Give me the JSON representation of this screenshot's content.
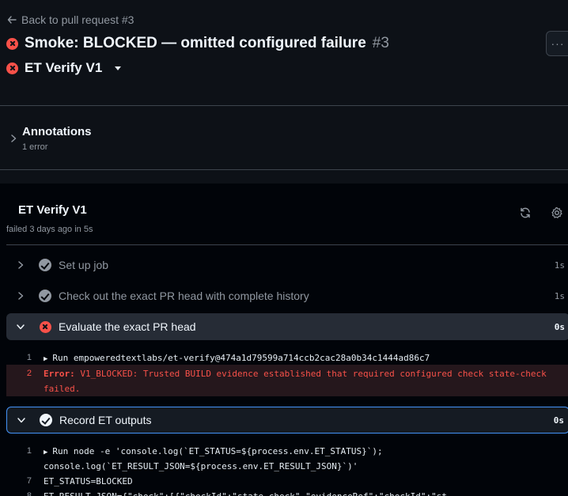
{
  "header": {
    "back_link": "Back to pull request #3",
    "title": "Smoke: BLOCKED — omitted configured failure",
    "run_number": "#3",
    "workflow": "ET Verify V1",
    "menu_glyph": "···"
  },
  "annotations": {
    "title": "Annotations",
    "count": "1 error"
  },
  "job": {
    "title": "ET Verify V1",
    "status": "failed 3 days ago in 5s"
  },
  "steps": [
    {
      "name": "Set up job",
      "duration": "1s",
      "status": "success",
      "expanded": false
    },
    {
      "name": "Check out the exact PR head with complete history",
      "duration": "1s",
      "status": "success",
      "expanded": false
    },
    {
      "name": "Evaluate the exact PR head",
      "duration": "0s",
      "status": "failure",
      "expanded": true
    },
    {
      "name": "Record ET outputs",
      "duration": "0s",
      "status": "success",
      "expanded": true
    }
  ],
  "log_evaluate": [
    {
      "n": "1",
      "text": "Run empoweredtextlabs/et-verify@474a1d79599a714ccb2cac28a0b34c1444ad86c7"
    },
    {
      "n": "2",
      "label": "Error:",
      "text": " V1_BLOCKED: Trusted BUILD evidence established that required configured check state-check failed."
    }
  ],
  "log_record": [
    {
      "n": "1",
      "text": "Run node -e 'console.log(`ET_STATUS=${process.env.ET_STATUS}`);"
    },
    {
      "n": "",
      "text": "console.log(`ET_RESULT_JSON=${process.env.ET_RESULT_JSON}`)'"
    },
    {
      "n": "7",
      "text": "ET_STATUS=BLOCKED"
    },
    {
      "n": "8",
      "text": "ET_RESULT_JSON={\"check\":[{\"checkId\":\"state-check\",\"evidenceRef\":\"checkId\":\"st"
    }
  ],
  "colors": {
    "background": "#0d1117",
    "panel": "#010409",
    "failure": "#f85149",
    "focus": "#4493f8",
    "muted": "#9198a1"
  }
}
